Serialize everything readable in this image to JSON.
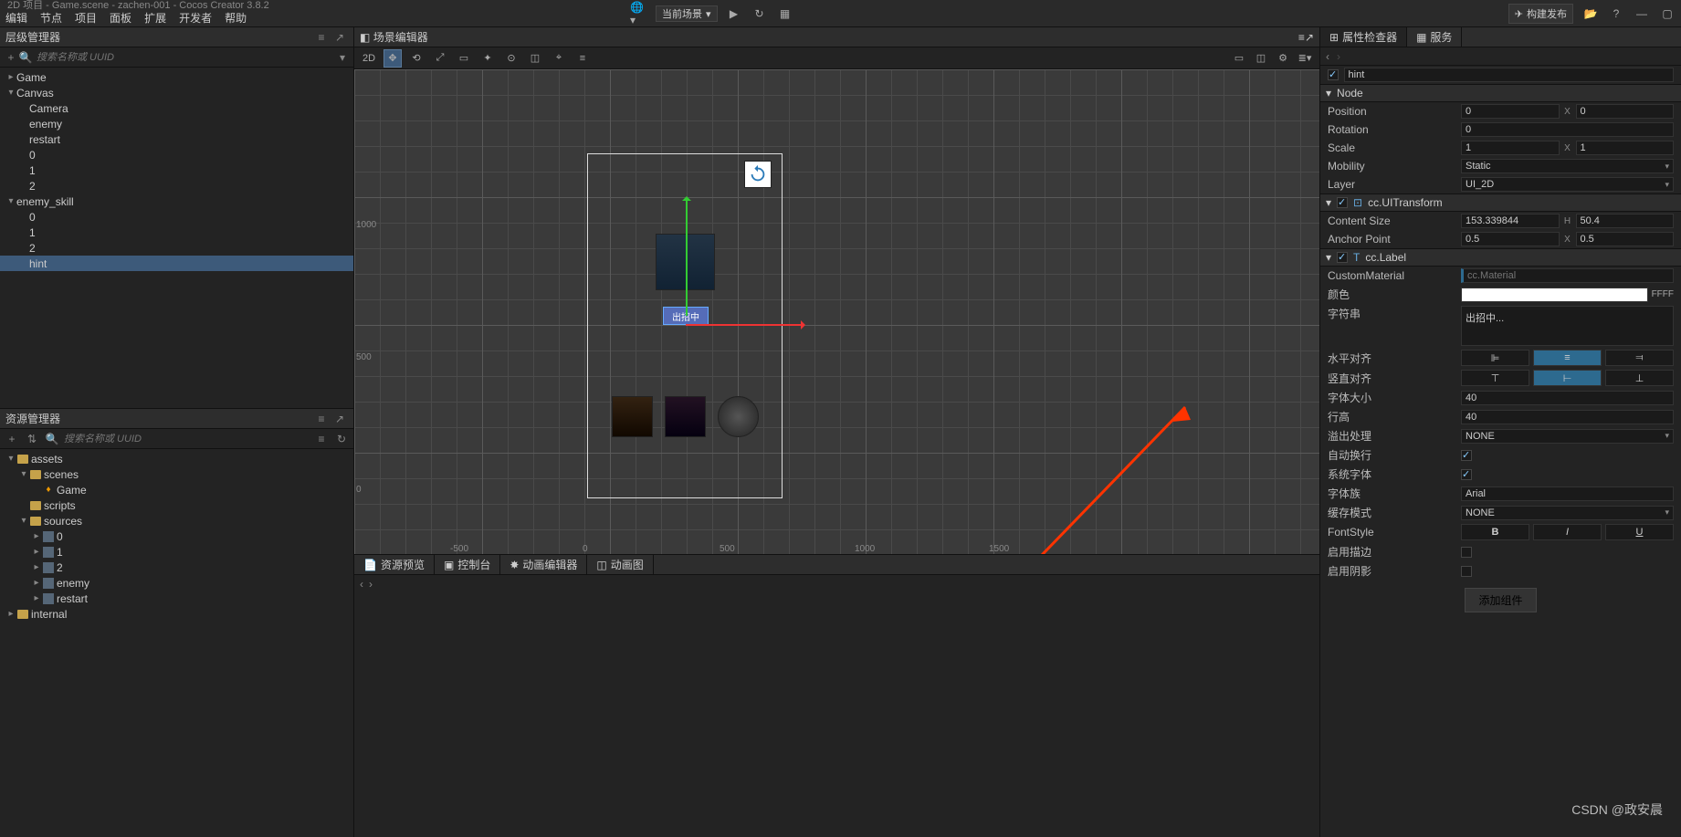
{
  "title": "2D 项目 - Game.scene - zachen-001 - Cocos Creator 3.8.2",
  "menu": [
    "编辑",
    "节点",
    "项目",
    "面板",
    "扩展",
    "开发者",
    "帮助"
  ],
  "top": {
    "scene_scope": "当前场景",
    "build": "构建发布"
  },
  "hierarchy": {
    "title": "层级管理器",
    "search_ph": "搜索名称或 UUID",
    "items": [
      {
        "d": 0,
        "tw": "▸",
        "n": "Game"
      },
      {
        "d": 0,
        "tw": "▾",
        "n": "Canvas"
      },
      {
        "d": 1,
        "tw": "",
        "n": "Camera"
      },
      {
        "d": 1,
        "tw": "",
        "n": "enemy"
      },
      {
        "d": 1,
        "tw": "",
        "n": "restart"
      },
      {
        "d": 1,
        "tw": "",
        "n": "0"
      },
      {
        "d": 1,
        "tw": "",
        "n": "1"
      },
      {
        "d": 1,
        "tw": "",
        "n": "2"
      },
      {
        "d": 0,
        "tw": "▾",
        "n": "enemy_skill"
      },
      {
        "d": 1,
        "tw": "",
        "n": "0"
      },
      {
        "d": 1,
        "tw": "",
        "n": "1"
      },
      {
        "d": 1,
        "tw": "",
        "n": "2"
      },
      {
        "d": 1,
        "tw": "",
        "n": "hint",
        "sel": true
      }
    ]
  },
  "assets": {
    "title": "资源管理器",
    "search_ph": "搜索名称或 UUID",
    "items": [
      {
        "d": 0,
        "tw": "▾",
        "ic": "db",
        "n": "assets"
      },
      {
        "d": 1,
        "tw": "▾",
        "ic": "folder",
        "n": "scenes"
      },
      {
        "d": 2,
        "tw": "",
        "ic": "fire",
        "n": "Game"
      },
      {
        "d": 1,
        "tw": "",
        "ic": "folder",
        "n": "scripts"
      },
      {
        "d": 1,
        "tw": "▾",
        "ic": "folder",
        "n": "sources"
      },
      {
        "d": 2,
        "tw": "▸",
        "ic": "img",
        "n": "0"
      },
      {
        "d": 2,
        "tw": "▸",
        "ic": "img",
        "n": "1"
      },
      {
        "d": 2,
        "tw": "▸",
        "ic": "img",
        "n": "2"
      },
      {
        "d": 2,
        "tw": "▸",
        "ic": "img",
        "n": "enemy"
      },
      {
        "d": 2,
        "tw": "▸",
        "ic": "img",
        "n": "restart"
      },
      {
        "d": 0,
        "tw": "▸",
        "ic": "db",
        "n": "internal"
      }
    ]
  },
  "scene": {
    "title": "场景编辑器",
    "mode": "2D",
    "ruler_y": [
      {
        "v": "1000",
        "t": 165
      },
      {
        "v": "500",
        "t": 310
      },
      {
        "v": "0",
        "t": 455
      }
    ],
    "ruler_x": [
      {
        "v": "-500",
        "l": 105
      },
      {
        "v": "0",
        "l": 250
      },
      {
        "v": "500",
        "l": 400
      },
      {
        "v": "1000",
        "l": 548
      },
      {
        "v": "1500",
        "l": 695
      }
    ],
    "sel_label": "出招中"
  },
  "bottom": {
    "tabs": [
      "资源预览",
      "控制台",
      "动画编辑器",
      "动画图"
    ]
  },
  "inspector": {
    "tabs": [
      "属性检查器",
      "服务"
    ],
    "node_name": "hint",
    "sec_node": "Node",
    "position": {
      "lbl": "Position",
      "x": "0",
      "y": "0"
    },
    "rotation": {
      "lbl": "Rotation",
      "v": "0"
    },
    "scale": {
      "lbl": "Scale",
      "x": "1",
      "y": "1"
    },
    "mobility": {
      "lbl": "Mobility",
      "v": "Static"
    },
    "layer": {
      "lbl": "Layer",
      "v": "UI_2D"
    },
    "sec_uitransform": "cc.UITransform",
    "content_size": {
      "lbl": "Content Size",
      "w": "153.339844",
      "h": "50.4"
    },
    "anchor": {
      "lbl": "Anchor Point",
      "x": "0.5",
      "y": "0.5"
    },
    "sec_label": "cc.Label",
    "custom_mat": {
      "lbl": "CustomMaterial",
      "ph": "cc.Material"
    },
    "color": {
      "lbl": "颜色",
      "hex": "FFFF"
    },
    "string": {
      "lbl": "字符串",
      "v": "出招中..."
    },
    "halign": {
      "lbl": "水平对齐"
    },
    "valign": {
      "lbl": "竖直对齐"
    },
    "font_size": {
      "lbl": "字体大小",
      "v": "40"
    },
    "line_h": {
      "lbl": "行高",
      "v": "40"
    },
    "overflow": {
      "lbl": "溢出处理",
      "v": "NONE"
    },
    "auto_wrap": {
      "lbl": "自动换行"
    },
    "sys_font": {
      "lbl": "系统字体"
    },
    "font_family": {
      "lbl": "字体族",
      "v": "Arial"
    },
    "cache_mode": {
      "lbl": "缓存模式",
      "v": "NONE"
    },
    "font_style": {
      "lbl": "FontStyle",
      "b": "B",
      "i": "I",
      "u": "U"
    },
    "outline": {
      "lbl": "启用描边"
    },
    "shadow": {
      "lbl": "启用阴影"
    },
    "add_comp": "添加组件"
  },
  "watermark": "CSDN @政安晨"
}
